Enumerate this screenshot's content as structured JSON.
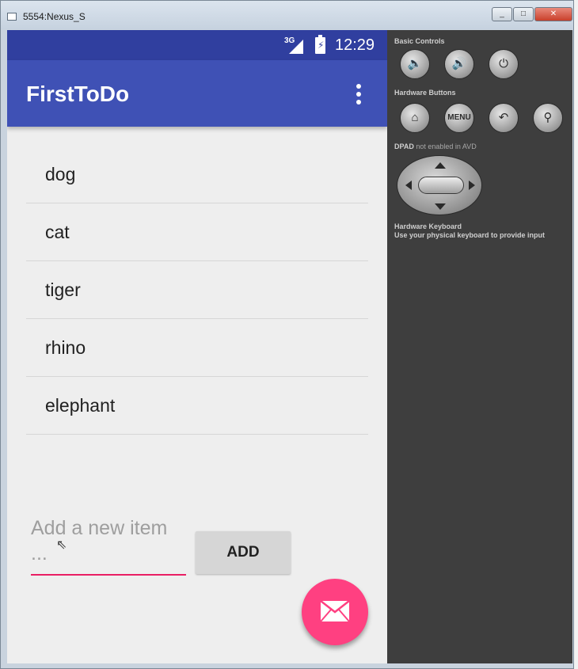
{
  "window": {
    "title": "5554:Nexus_S",
    "minimize": "_",
    "maximize": "□",
    "close": "✕"
  },
  "statusbar": {
    "network": "3G",
    "time": "12:29"
  },
  "app": {
    "title": "FirstToDo",
    "accent": "#3f51b5",
    "status_color": "#303f9f",
    "fab_color": "#ff4081"
  },
  "items": [
    "dog",
    "cat",
    "tiger",
    "rhino",
    "elephant"
  ],
  "input": {
    "placeholder": "Add a new item ..."
  },
  "add_button": {
    "label": "ADD"
  },
  "controls": {
    "basic_title": "Basic Controls",
    "hardware_title": "Hardware Buttons",
    "menu_label": "MENU",
    "dpad_title": "DPAD",
    "dpad_note": "not enabled in AVD",
    "keyboard_title": "Hardware Keyboard",
    "keyboard_note": "Use your physical keyboard to provide input"
  }
}
